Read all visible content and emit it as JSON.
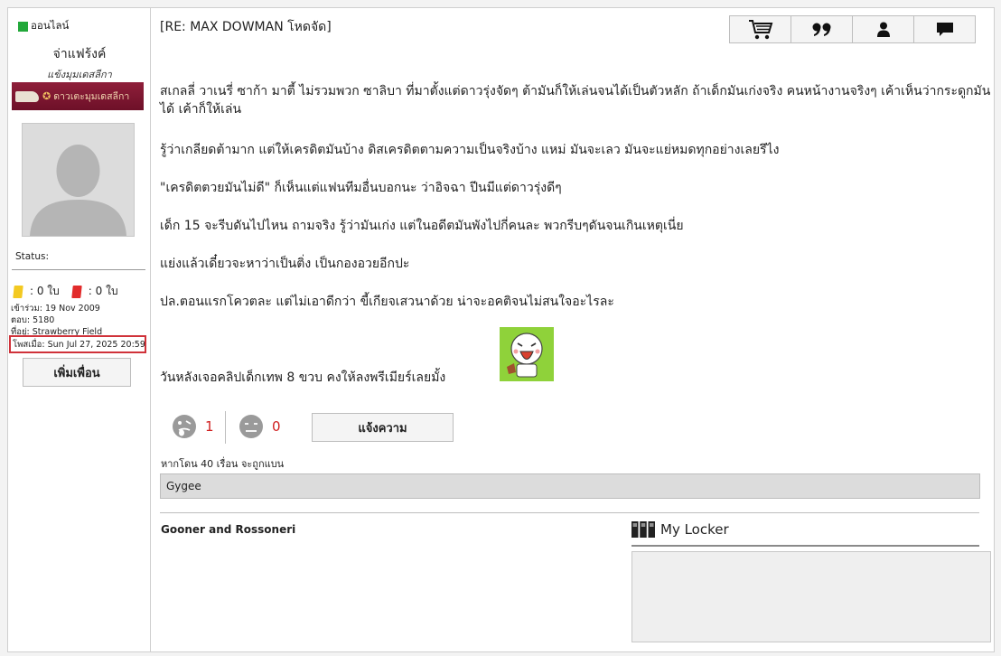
{
  "profile": {
    "online_label": "ออนไลน์",
    "username": "จ่าแฟร้งค์",
    "rank_title": "แข้งมุมเดสลีกา",
    "rank_badge_text": "ดาวเตะมุมเดสลีกา",
    "status_label": "Status:",
    "yellow_cards": ": 0 ใบ",
    "red_cards": ": 0 ใบ",
    "joined": "เข้าร่วม: 19 Nov 2009",
    "replies": "ตอบ: 5180",
    "location": "ที่อยู่: Strawberry Field",
    "posted_at": "โพสเมื่อ: Sun Jul 27, 2025 20:59",
    "add_friend_label": "เพิ่มเพื่อน"
  },
  "post": {
    "title": "[RE: MAX DOWMAN โหดจัด]",
    "paragraphs": [
      "สเกลลี่ วาเนรี่ ซาก้า มาตี้ ไม่รวมพวก ซาลิบา ที่มาตั้งแต่ดาวรุ่งจัดๆ ต้ามันก็ให้เล่นจนได้เป็นตัวหลัก ถ้าเด็กมันเก่งจริง คนหน้างานจริงๆ เค้าเห็นว่ากระดูกมันได้ เค้าก็ให้เล่น",
      "รู้ว่าเกลียดต้ามาก แต่ให้เครดิตมันบ้าง ดิสเครดิตตามความเป็นจริงบ้าง แหม่ มันจะเลว มันจะแย่หมดทุกอย่างเลยรึไง",
      "\"เครดิตตวยมันไม่ดี\" ก็เห็นแต่แฟนทีมอื่นบอกนะ ว่าอิจฉา ปีนมีแต่ดาวรุ่งดีๆ",
      "เด็ก 15 จะรีบดันไปไหน ถามจริง รู้ว่ามันเก่ง แต่ในอดีตมันพังไปกี่คนละ พวกรีบๆดันจนเกินเหตุเนี่ย",
      "แย่งแล้วเดี๋ยวจะหาว่าเป็นติ่ง เป็นกองอวยอีกปะ",
      "ปล.ตอนแรกโควตละ แต่ไม่เอาดีกว่า ขี้เกียจเสวนาด้วย น่าจะอคติจนไม่สนใจอะไรละ",
      "วันหลังเจอคลิปเด็กเทพ 8 ขวบ คงให้ลงพรีเมียร์เลยมั้ง"
    ],
    "like_count": "1",
    "dislike_count": "0",
    "report_label": "แจ้งความ",
    "ban_note": "หากโดน 40 เรื่อน จะถูกแบน",
    "reporter": "Gygee",
    "signature": "Gooner and Rossoneri",
    "locker_title": "My Locker"
  },
  "toolbar": {
    "icons": [
      "cart-icon",
      "quote-icon",
      "user-icon",
      "message-icon"
    ]
  },
  "colors": {
    "online": "#22a83a",
    "badge": "#7b1530",
    "highlight_border": "#d0323a",
    "count_red": "#d02020"
  }
}
